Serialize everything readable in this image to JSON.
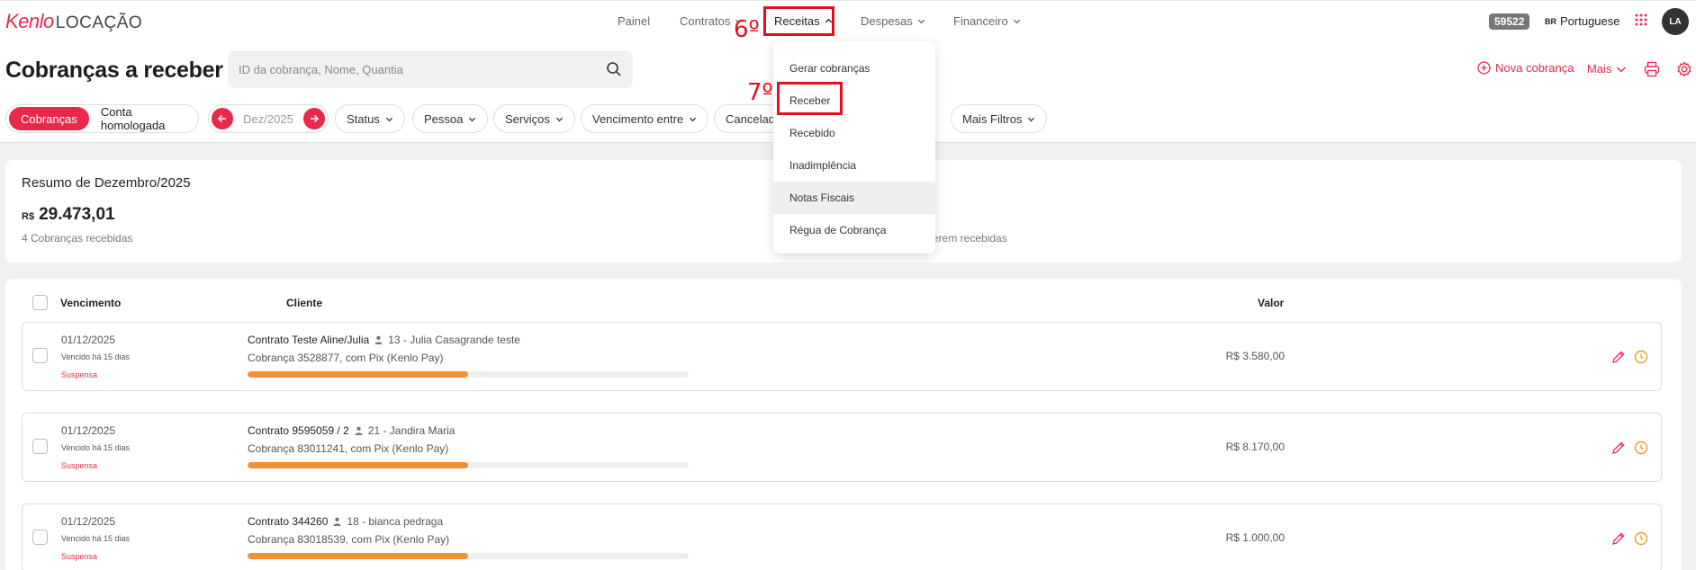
{
  "brand": {
    "name_part1": "Kenlo",
    "name_part2": "LOCAÇÃO",
    "accent_color": "#e8294a"
  },
  "nav": {
    "items": [
      {
        "label": "Painel"
      },
      {
        "label": "Contratos"
      },
      {
        "label": "Receitas"
      },
      {
        "label": "Despesas"
      },
      {
        "label": "Financeiro"
      }
    ]
  },
  "topbar_right": {
    "version": "59522",
    "lang_flag": "BR",
    "lang": "Portuguese",
    "avatar": "LA"
  },
  "page": {
    "title": "Cobranças a receber",
    "search_placeholder": "ID da cobrança, Nome, Quantia",
    "new_label": "Nova cobrança",
    "more_label": "Mais"
  },
  "filters": {
    "toggle": [
      "Cobranças",
      "Conta homologada"
    ],
    "period": "Dez/2025",
    "chips": [
      "Status",
      "Pessoa",
      "Serviços",
      "Vencimento entre",
      "Cancelad",
      "Mais Filtros"
    ]
  },
  "summary": {
    "title": "Resumo de Dezembro/2025",
    "currency": "R$",
    "amount": "29.473,01",
    "received_text": "4 Cobranças recebidas",
    "right_text": "erem recebidas"
  },
  "table": {
    "headers": {
      "due": "Vencimento",
      "client": "Cliente",
      "value": "Valor"
    },
    "rows": [
      {
        "date": "01/12/2025",
        "overdue": "Vencido há 15 dias",
        "status": "Suspensa",
        "contract": "Contrato Teste Aline/Julia",
        "person": "13 - Julia Casagrande teste",
        "charge": "Cobrança 3528877, com Pix (Kenlo Pay)",
        "value": "R$ 3.580,00",
        "progress": 0.5
      },
      {
        "date": "01/12/2025",
        "overdue": "Vencido há 15 dias",
        "status": "Suspensa",
        "contract": "Contrato 9595059 / 2",
        "person": "21 - Jandira Maria",
        "charge": "Cobrança 83011241, com Pix (Kenlo Pay)",
        "value": "R$ 8.170,00",
        "progress": 0.5
      },
      {
        "date": "01/12/2025",
        "overdue": "Vencido há 15 dias",
        "status": "Suspensa",
        "contract": "Contrato 344260",
        "person": "18 - bianca pedraga",
        "charge": "Cobrança 83018539, com Pix (Kenlo Pay)",
        "value": "R$ 1.000,00",
        "progress": 0.5
      }
    ]
  },
  "dropdown": {
    "items": [
      "Gerar cobranças",
      "Receber",
      "Recebido",
      "Inadimplência",
      "Notas Fiscais",
      "Régua de Cobrança"
    ],
    "hovered": "Notas Fiscais"
  },
  "annotations": {
    "step6": "6º",
    "step7": "7º",
    "color": "#e0101e"
  }
}
